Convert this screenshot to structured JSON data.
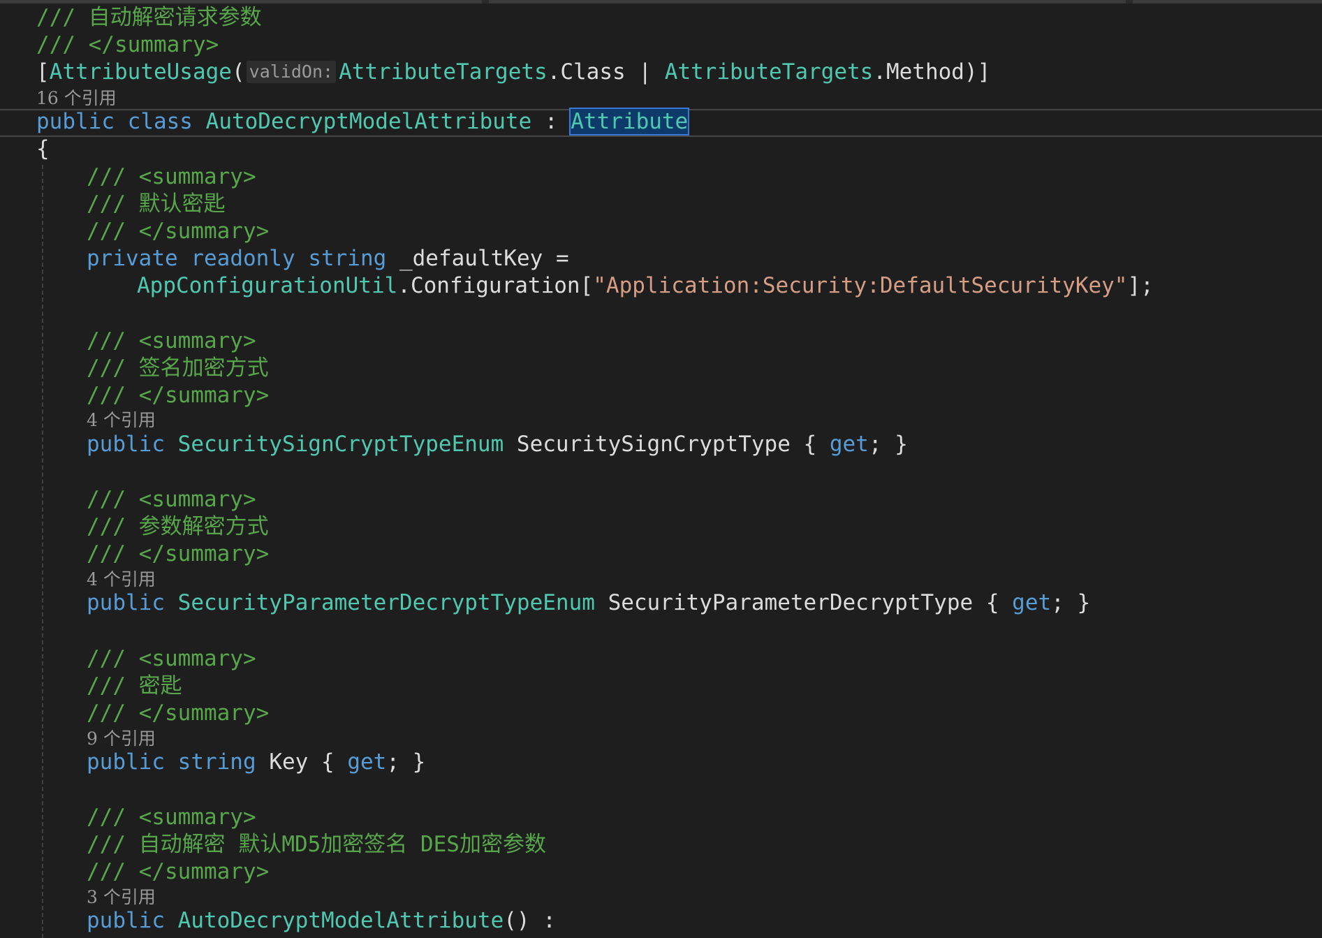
{
  "lines": {
    "l1": {
      "comment": "/// 自动解密请求参数"
    },
    "l2": {
      "comment": "/// </summary>"
    },
    "l3": {
      "open": "[",
      "attr": "AttributeUsage",
      "paren": "(",
      "hint": "validOn:",
      "t1": "AttributeTargets",
      "dot1": ".",
      "m1": "Class",
      "bar": " | ",
      "t2": "AttributeTargets",
      "dot2": ".",
      "m2": "Method",
      "close": ")]"
    },
    "r1": "16 个引用",
    "l4": {
      "kw1": "public",
      "kw2": "class",
      "name": "AutoDecryptModelAttribute",
      "colon": " : ",
      "base": "Attribute"
    },
    "l5": {
      "brace": "{"
    },
    "l6": {
      "comment": "/// <summary>"
    },
    "l7": {
      "comment": "/// 默认密匙"
    },
    "l8": {
      "comment": "/// </summary>"
    },
    "l9": {
      "kw1": "private",
      "kw2": "readonly",
      "kw3": "string",
      "field": "_defaultKey",
      "eq": " ="
    },
    "l10": {
      "type": "AppConfigurationUtil",
      "dot": ".",
      "member": "Configuration",
      "lb": "[",
      "str": "\"Application:Security:DefaultSecurityKey\"",
      "rb": "];"
    },
    "l11": {
      "comment": "/// <summary>"
    },
    "l12": {
      "comment": "/// 签名加密方式"
    },
    "l13": {
      "comment": "/// </summary>"
    },
    "r2": "4 个引用",
    "l14": {
      "kw": "public",
      "type": "SecuritySignCryptTypeEnum",
      "prop": "SecuritySignCryptType",
      "ob": " { ",
      "get": "get",
      "cb": "; }"
    },
    "l15": {
      "comment": "/// <summary>"
    },
    "l16": {
      "comment": "/// 参数解密方式"
    },
    "l17": {
      "comment": "/// </summary>"
    },
    "r3": "4 个引用",
    "l18": {
      "kw": "public",
      "type": "SecurityParameterDecryptTypeEnum",
      "prop": "SecurityParameterDecryptType",
      "ob": " { ",
      "get": "get",
      "cb": "; }"
    },
    "l19": {
      "comment": "/// <summary>"
    },
    "l20": {
      "comment": "/// 密匙"
    },
    "l21": {
      "comment": "/// </summary>"
    },
    "r4": "9 个引用",
    "l22": {
      "kw1": "public",
      "kw2": "string",
      "prop": "Key",
      "ob": " { ",
      "get": "get",
      "cb": "; }"
    },
    "l23": {
      "comment": "/// <summary>"
    },
    "l24": {
      "comment": "/// 自动解密 默认MD5加密签名 DES加密参数"
    },
    "l25": {
      "comment": "/// </summary>"
    },
    "r5": "3 个引用",
    "l26": {
      "kw": "public",
      "name": "AutoDecryptModelAttribute",
      "tail": "() :"
    }
  },
  "colors": {
    "background": "#1e1e1e",
    "comment": "#57a64a",
    "keyword": "#569cd6",
    "type": "#4ec9b0",
    "string": "#d69d85",
    "selection_outline": "#3c78d8"
  }
}
